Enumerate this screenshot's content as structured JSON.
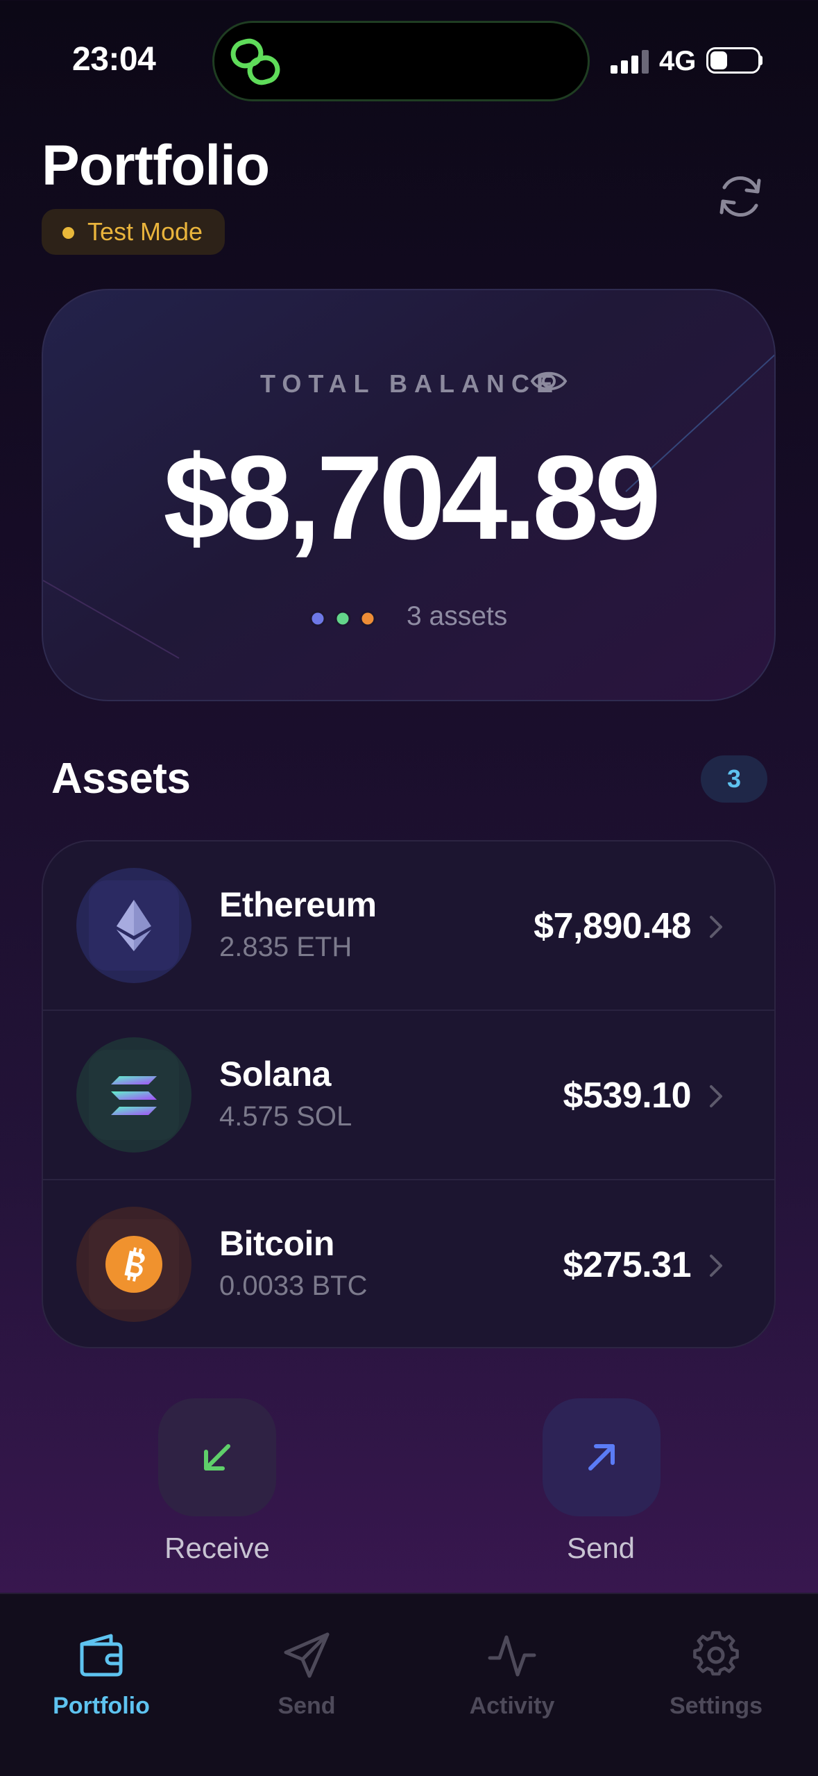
{
  "status_bar": {
    "time": "23:04",
    "network": "4G"
  },
  "header": {
    "title": "Portfolio",
    "mode_badge": "Test Mode"
  },
  "balance_card": {
    "label": "TOTAL BALANCE",
    "amount": "$8,704.89",
    "assets_count": "3 assets"
  },
  "assets_section": {
    "title": "Assets",
    "count": "3",
    "items": [
      {
        "name": "Ethereum",
        "quantity": "2.835 ETH",
        "value": "$7,890.48",
        "icon": "ethereum-icon"
      },
      {
        "name": "Solana",
        "quantity": "4.575 SOL",
        "value": "$539.10",
        "icon": "solana-icon"
      },
      {
        "name": "Bitcoin",
        "quantity": "0.0033 BTC",
        "value": "$275.31",
        "icon": "bitcoin-icon"
      }
    ]
  },
  "actions": {
    "receive": "Receive",
    "send": "Send"
  },
  "tab_bar": {
    "items": [
      {
        "label": "Portfolio",
        "icon": "wallet-icon",
        "active": true
      },
      {
        "label": "Send",
        "icon": "paper-plane-icon",
        "active": false
      },
      {
        "label": "Activity",
        "icon": "activity-icon",
        "active": false
      },
      {
        "label": "Settings",
        "icon": "gear-icon",
        "active": false
      }
    ]
  },
  "colors": {
    "accent": "#5ec3f0",
    "badge_text": "#e9b43c",
    "receive_arrow": "#5fcf6a",
    "send_arrow": "#5b7cf6",
    "bitcoin": "#f0922e",
    "ethereum": "#8a8fcf",
    "solana": "#6cf0c0"
  }
}
